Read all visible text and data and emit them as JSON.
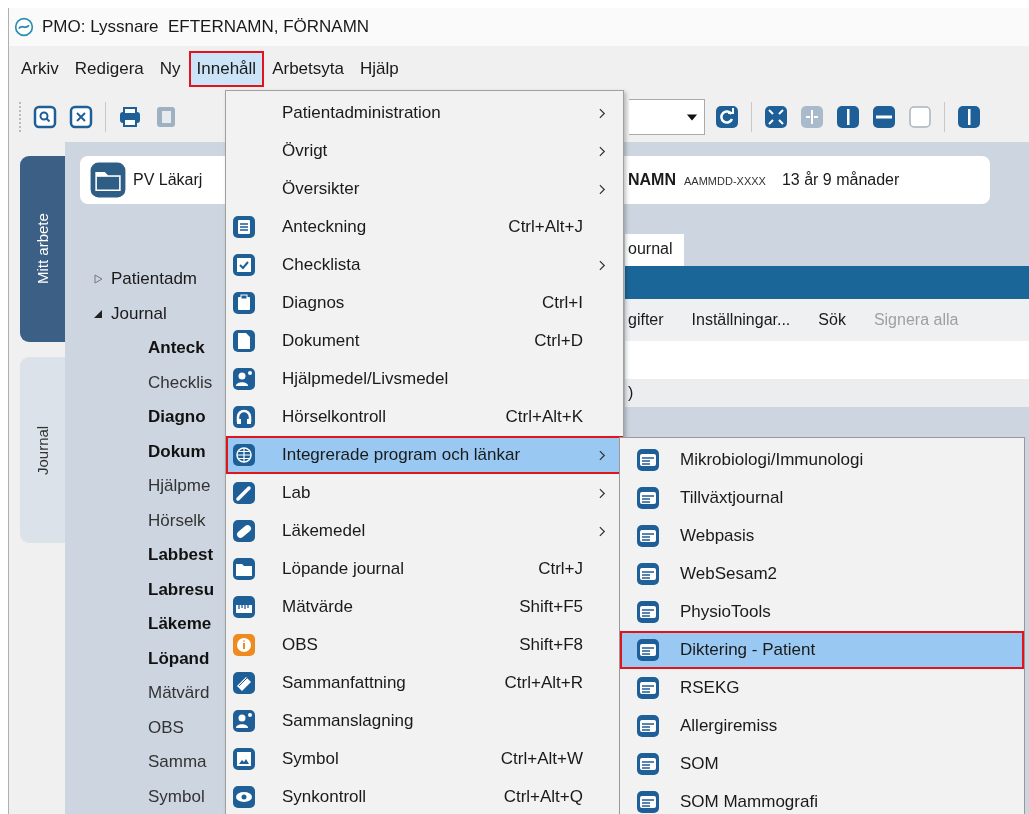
{
  "window": {
    "title": "PMO: Lyssnare  EFTERNAMN, FÖRNAMN"
  },
  "menubar": [
    {
      "label": "Arkiv",
      "selected": false,
      "marked": false
    },
    {
      "label": "Redigera",
      "selected": false,
      "marked": false
    },
    {
      "label": "Ny",
      "selected": false,
      "marked": false
    },
    {
      "label": "Innehåll",
      "selected": true,
      "marked": true
    },
    {
      "label": "Arbetsyta",
      "selected": false,
      "marked": false
    },
    {
      "label": "Hjälp",
      "selected": false,
      "marked": false
    }
  ],
  "side_tabs": [
    {
      "label": "Mitt arbete",
      "selected": true
    },
    {
      "label": "Journal",
      "selected": false
    }
  ],
  "header": {
    "unit": "PV Läkarj",
    "name": "NAMN",
    "id": "AAMMDD-XXXX",
    "age": "13 år 9 månader"
  },
  "tree": [
    {
      "label": "Patientadm",
      "expanded": false
    },
    {
      "label": "Journal",
      "expanded": true,
      "children": [
        {
          "label": "Anteck",
          "bold": true
        },
        {
          "label": "Checklis",
          "bold": false
        },
        {
          "label": "Diagno",
          "bold": true
        },
        {
          "label": "Dokum",
          "bold": true
        },
        {
          "label": "Hjälpme",
          "bold": false
        },
        {
          "label": "Hörselk",
          "bold": false
        },
        {
          "label": "Labbest",
          "bold": true
        },
        {
          "label": "Labresu",
          "bold": true
        },
        {
          "label": "Läkeme",
          "bold": true
        },
        {
          "label": "Löpand",
          "bold": true
        },
        {
          "label": "Mätvärd",
          "bold": false
        },
        {
          "label": "OBS",
          "bold": false
        },
        {
          "label": "Samma",
          "bold": false
        },
        {
          "label": "Symbol",
          "bold": false
        }
      ]
    }
  ],
  "content_tabs": [
    {
      "label": "ournal",
      "selected": true
    }
  ],
  "actions": [
    {
      "label": "gifter",
      "disabled": false
    },
    {
      "label": "Inställningar...",
      "disabled": false
    },
    {
      "label": "Sök",
      "disabled": false
    },
    {
      "label": "Signera alla",
      "disabled": true
    }
  ],
  "row_text": ")",
  "menu": {
    "items": [
      {
        "label": "Patientadministration",
        "has_submenu": true,
        "selected": false,
        "marked": false
      },
      {
        "label": "Övrigt",
        "has_submenu": true,
        "selected": false,
        "marked": false
      },
      {
        "label": "Översikter",
        "has_submenu": true,
        "selected": false,
        "marked": false
      },
      {
        "label": "Anteckning",
        "shortcut": "Ctrl+Alt+J",
        "has_submenu": false,
        "selected": false,
        "marked": false
      },
      {
        "label": "Checklista",
        "has_submenu": true,
        "selected": false,
        "marked": false
      },
      {
        "label": "Diagnos",
        "shortcut": "Ctrl+I",
        "has_submenu": false,
        "selected": false,
        "marked": false
      },
      {
        "label": "Dokument",
        "shortcut": "Ctrl+D",
        "has_submenu": false,
        "selected": false,
        "marked": false
      },
      {
        "label": "Hjälpmedel/Livsmedel",
        "has_submenu": false,
        "selected": false,
        "marked": false
      },
      {
        "label": "Hörselkontroll",
        "shortcut": "Ctrl+Alt+K",
        "has_submenu": false,
        "selected": false,
        "marked": false
      },
      {
        "label": "Integrerade program och länkar",
        "has_submenu": true,
        "selected": true,
        "marked": true
      },
      {
        "label": "Lab",
        "has_submenu": true,
        "selected": false,
        "marked": false
      },
      {
        "label": "Läkemedel",
        "has_submenu": true,
        "selected": false,
        "marked": false
      },
      {
        "label": "Löpande journal",
        "shortcut": "Ctrl+J",
        "has_submenu": false,
        "selected": false,
        "marked": false
      },
      {
        "label": "Mätvärde",
        "shortcut": "Shift+F5",
        "has_submenu": false,
        "selected": false,
        "marked": false
      },
      {
        "label": "OBS",
        "shortcut": "Shift+F8",
        "has_submenu": false,
        "selected": false,
        "marked": false
      },
      {
        "label": "Sammanfattning",
        "shortcut": "Ctrl+Alt+R",
        "has_submenu": false,
        "selected": false,
        "marked": false
      },
      {
        "label": "Sammanslagning",
        "has_submenu": false,
        "selected": false,
        "marked": false
      },
      {
        "label": "Symbol",
        "shortcut": "Ctrl+Alt+W",
        "has_submenu": false,
        "selected": false,
        "marked": false
      },
      {
        "label": "Synkontroll",
        "shortcut": "Ctrl+Alt+Q",
        "has_submenu": false,
        "selected": false,
        "marked": false
      }
    ]
  },
  "submenu": {
    "items": [
      {
        "label": "Mikrobiologi/Immunologi",
        "selected": false,
        "marked": false
      },
      {
        "label": "Tillväxtjournal",
        "selected": false,
        "marked": false
      },
      {
        "label": "Webpasis",
        "selected": false,
        "marked": false
      },
      {
        "label": "WebSesam2",
        "selected": false,
        "marked": false
      },
      {
        "label": "PhysioTools",
        "selected": false,
        "marked": false
      },
      {
        "label": "Diktering - Patient",
        "selected": true,
        "marked": true
      },
      {
        "label": "RSEKG",
        "selected": false,
        "marked": false
      },
      {
        "label": "Allergiremiss",
        "selected": false,
        "marked": false
      },
      {
        "label": "SOM",
        "selected": false,
        "marked": false
      },
      {
        "label": "SOM Mammografi",
        "selected": false,
        "marked": false
      }
    ]
  }
}
